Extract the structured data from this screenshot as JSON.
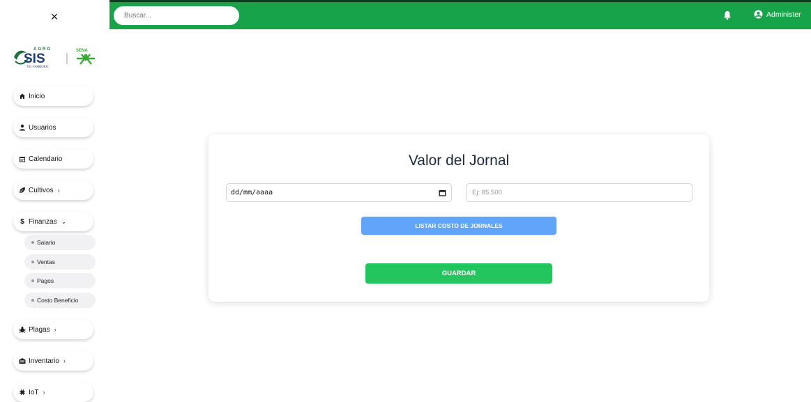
{
  "sidebar": {
    "close_icon": "×",
    "logo_agro": "AGRO",
    "logo_sis": "SIS",
    "logo_sub": "TIC-YAMBORO",
    "logo_sena": "SENA",
    "items": [
      {
        "label": "Inicio",
        "icon": "home-icon"
      },
      {
        "label": "Usuarios",
        "icon": "user-icon"
      },
      {
        "label": "Calendario",
        "icon": "calendar-icon"
      },
      {
        "label": "Cultivos",
        "icon": "leaf-icon",
        "chevron": "›"
      },
      {
        "label": "Finanzas",
        "icon": "dollar-icon",
        "chevron": "⌄"
      },
      {
        "label": "Plagas",
        "icon": "bug-icon",
        "chevron": "›"
      },
      {
        "label": "Inventario",
        "icon": "warehouse-icon",
        "chevron": "›"
      },
      {
        "label": "IoT",
        "icon": "chip-icon",
        "chevron": "›"
      }
    ],
    "finanzas_sub": [
      "Salario",
      "Ventas",
      "Pagos",
      "Costo Beneficio"
    ]
  },
  "topbar": {
    "search_placeholder": "Buscar...",
    "user_name": "Administer",
    "color": "#16a34a"
  },
  "form": {
    "title": "Valor del Jornal",
    "date_value": "dd/mm/aaaa",
    "value_placeholder": "Ej: 85.500",
    "list_button": "LISTAR COSTO DE JORNALES",
    "save_button": "GUARDAR",
    "list_color": "#60a5fa",
    "save_color": "#22c55e"
  }
}
